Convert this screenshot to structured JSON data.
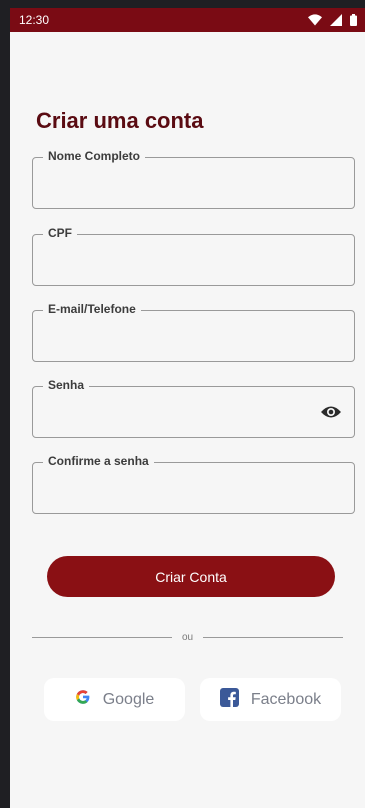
{
  "status_bar": {
    "time": "12:30"
  },
  "form": {
    "title": "Criar uma conta",
    "fields": [
      {
        "label": "Nome Completo",
        "value": ""
      },
      {
        "label": "CPF",
        "value": ""
      },
      {
        "label": "E-mail/Telefone",
        "value": ""
      },
      {
        "label": "Senha",
        "value": ""
      },
      {
        "label": "Confirme a senha",
        "value": ""
      }
    ],
    "submit_label": "Criar Conta"
  },
  "divider_text": "ou",
  "social": {
    "google_label": "Google",
    "facebook_label": "Facebook"
  },
  "colors": {
    "status_bar": "#7a0b14",
    "title": "#5a0b12",
    "primary_button": "#8a1014",
    "facebook_icon": "#3b5998"
  }
}
